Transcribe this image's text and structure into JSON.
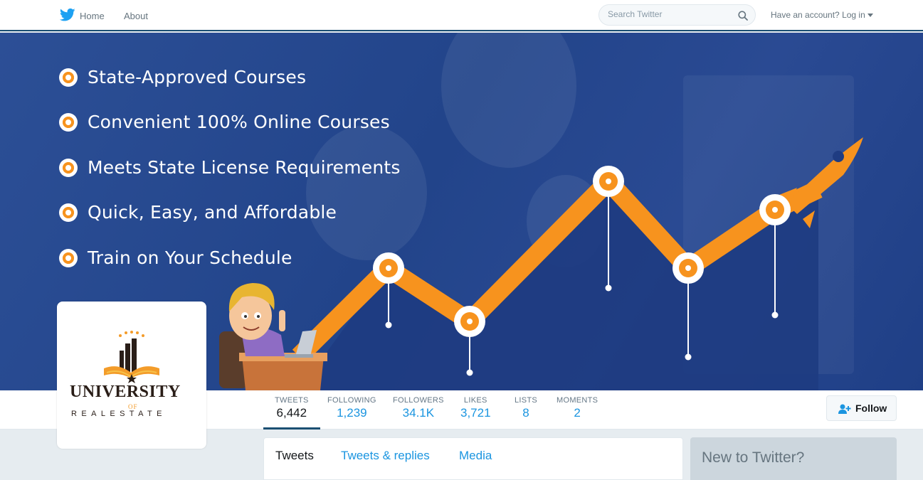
{
  "nav": {
    "home_label": "Home",
    "about_label": "About",
    "search_placeholder": "Search Twitter",
    "login_label": "Have an account? Log in"
  },
  "banner": {
    "bullets": [
      "State-Approved Courses",
      "Convenient 100% Online Courses",
      "Meets State License Requirements",
      "Quick, Easy, and Affordable",
      "Train on Your Schedule"
    ],
    "accent_color": "#f7931e",
    "background_color": "#22448a"
  },
  "profile": {
    "logo_title": "UNIVERSITY",
    "logo_of": "OF",
    "logo_subtitle": "REALESTATE"
  },
  "stats": [
    {
      "label": "TWEETS",
      "value": "6,442"
    },
    {
      "label": "FOLLOWING",
      "value": "1,239"
    },
    {
      "label": "FOLLOWERS",
      "value": "34.1K"
    },
    {
      "label": "LIKES",
      "value": "3,721"
    },
    {
      "label": "LISTS",
      "value": "8"
    },
    {
      "label": "MOMENTS",
      "value": "2"
    }
  ],
  "follow_label": "Follow",
  "timeline_tabs": [
    "Tweets",
    "Tweets & replies",
    "Media"
  ],
  "sidebar": {
    "title": "New to Twitter?"
  }
}
